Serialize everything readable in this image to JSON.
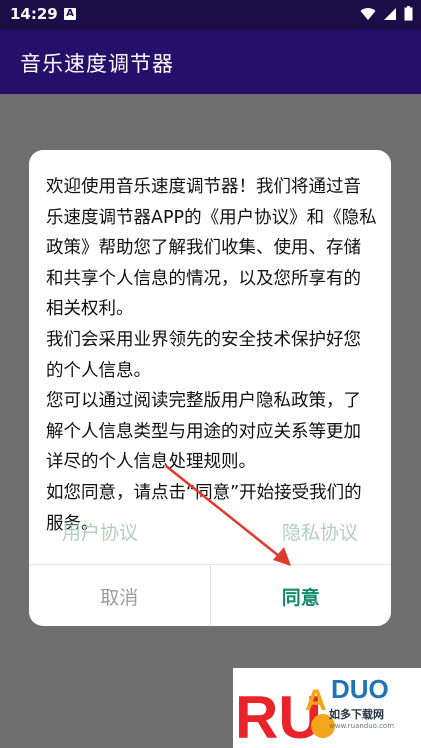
{
  "status_bar": {
    "time": "14:29",
    "notification_glyph": "A"
  },
  "app_bar": {
    "title": "音乐速度调节器"
  },
  "dialog": {
    "paragraphs": [
      "欢迎使用音乐速度调节器！我们将通过音乐速度调节器APP的《用户协议》和《隐私政策》帮助您了解我们收集、使用、存储和共享个人信息的情况，以及您所享有的相关权利。",
      "我们会采用业界领先的安全技术保护好您的个人信息。",
      "您可以通过阅读完整版用户隐私政策，了解个人信息类型与用途的对应关系等更加详尽的个人信息处理规则。",
      "如您同意，请点击“同意”开始接受我们的服务。"
    ],
    "user_agreement_link": "用户协议",
    "privacy_agreement_link": "隐私协议",
    "cancel_label": "取消",
    "agree_label": "同意"
  },
  "watermark": {
    "logo_text": "RUANDUO",
    "cn_text": "如多下载网",
    "url": "www.ruanduo.com"
  },
  "colors": {
    "status_bar": "#1b0d45",
    "app_bar": "#24106b",
    "scrim": "#6f6f6f",
    "agree": "#148a6c",
    "link": "#b2cfbd",
    "arrow": "#e03a2f"
  }
}
